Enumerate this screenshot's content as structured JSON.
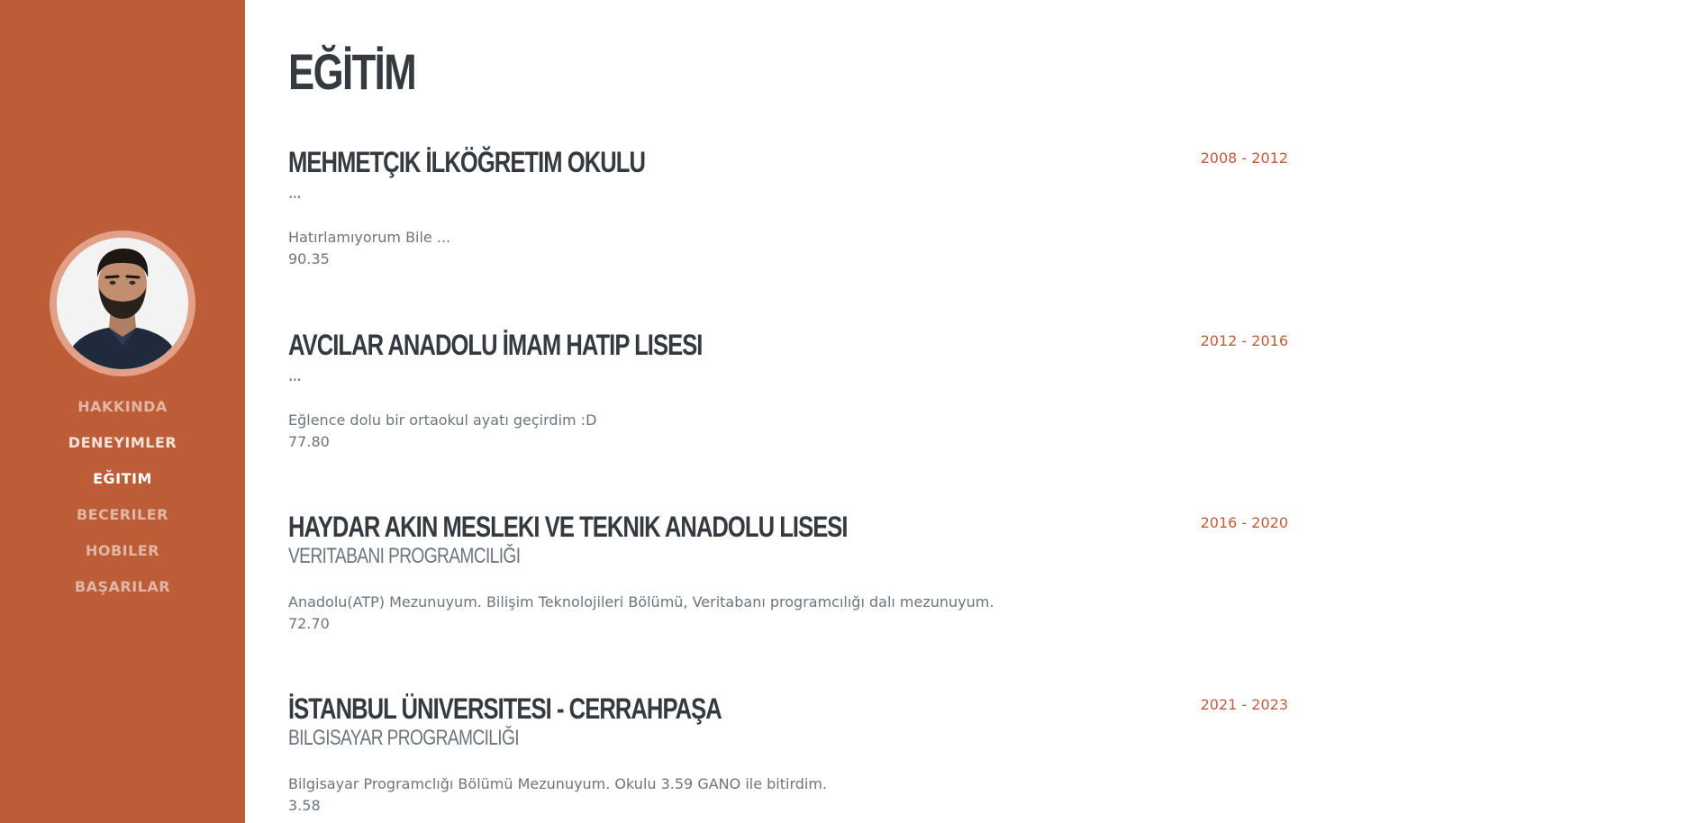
{
  "sidebar": {
    "nav": [
      {
        "label": "HAKKINDA"
      },
      {
        "label": "DENEYIMLER"
      },
      {
        "label": "EĞITIM"
      },
      {
        "label": "BECERILER"
      },
      {
        "label": "HOBILER"
      },
      {
        "label": "BAŞARILAR"
      }
    ],
    "active_item": "EĞITIM",
    "accent_color": "#bd5d38"
  },
  "main": {
    "section_title": "EĞİTİM",
    "entries": [
      {
        "school": "MEHMETÇIK İLKÖĞRETIM OKULU",
        "program": "...",
        "description": "Hatırlamıyorum Bile ...",
        "score": "90.35",
        "dates": "2008 - 2012"
      },
      {
        "school": "AVCILAR ANADOLU İMAM HATIP LISESI",
        "program": "...",
        "description": "Eğlence dolu bir ortaokul ayatı geçirdim :D",
        "score": "77.80",
        "dates": "2012 - 2016"
      },
      {
        "school": "HAYDAR AKIN MESLEKI VE TEKNIK ANADOLU LISESI",
        "program": "VERITABANI PROGRAMCILIĞI",
        "description": "Anadolu(ATP) Mezunuyum. Bilişim Teknolojileri Bölümü, Veritabanı programcılığı dalı mezunuyum.",
        "score": "72.70",
        "dates": "2016 - 2020"
      },
      {
        "school": "İSTANBUL ÜNIVERSITESI - CERRAHPAŞA",
        "program": "BILGISAYAR PROGRAMCILIĞI",
        "description": "Bilgisayar Programclığı Bölümü Mezunuyum. Okulu 3.59 GANO ile bitirdim.",
        "score": "3.58",
        "dates": "2021 - 2023"
      }
    ]
  }
}
